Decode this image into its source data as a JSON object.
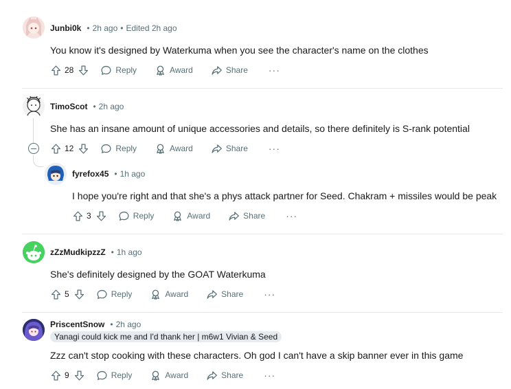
{
  "comments": [
    {
      "username": "Junbi0k",
      "time": "2h ago",
      "edited": "Edited 2h ago",
      "text": "You know it's designed by Waterkuma when you see the character's name on the clothes",
      "votes": "28",
      "reply_label": "Reply",
      "award_label": "Award",
      "share_label": "Share",
      "more_label": "···"
    },
    {
      "username": "TimoScot",
      "time": "2h ago",
      "text": "She has an insane amount of unique accessories and details, so there definitely is S-rank potential",
      "votes": "12",
      "reply_label": "Reply",
      "award_label": "Award",
      "share_label": "Share",
      "more_label": "···"
    },
    {
      "username": "fyrefox45",
      "time": "1h ago",
      "text": "I hope you're right and that she's a phys attack partner for Seed. Chakram + missiles would be peak",
      "votes": "3",
      "reply_label": "Reply",
      "award_label": "Award",
      "share_label": "Share",
      "more_label": "···"
    },
    {
      "username": "zZzMudkipzzZ",
      "time": "1h ago",
      "text": "She's definitely designed by the GOAT Waterkuma",
      "votes": "5",
      "reply_label": "Reply",
      "award_label": "Award",
      "share_label": "Share",
      "more_label": "···"
    },
    {
      "username": "PriscentSnow",
      "time": "2h ago",
      "flair": "Yanagi could kick me and I'd thank her | m6w1 Vivian & Seed",
      "text": "Zzz can't stop cooking with these characters. Oh god I can't have a skip banner ever in this game",
      "votes": "9",
      "reply_label": "Reply",
      "award_label": "Award",
      "share_label": "Share",
      "more_label": "···"
    }
  ],
  "colors": {
    "meta": "#576f76",
    "text": "#1a1a1b",
    "flair_bg": "#e5ebee",
    "snoo_green": "#46d160"
  }
}
